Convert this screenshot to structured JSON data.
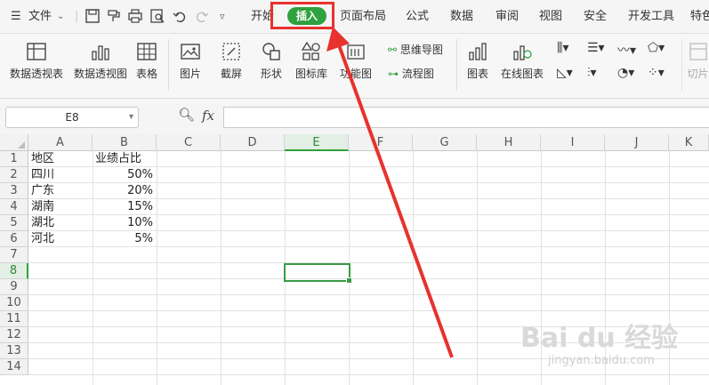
{
  "menu": {
    "file_label": "文件",
    "tabs": [
      "开始",
      "插入",
      "页面布局",
      "公式",
      "数据",
      "审阅",
      "视图",
      "安全",
      "开发工具",
      "特色"
    ]
  },
  "ribbon": {
    "buttons": [
      "数据透视表",
      "数据透视图",
      "表格",
      "图片",
      "截屏",
      "形状",
      "图标库",
      "功能图",
      "图表",
      "在线图表",
      "切片"
    ],
    "small": [
      "思维导图",
      "流程图"
    ]
  },
  "formula_bar": {
    "name_box": "E8",
    "fx": "fx"
  },
  "sheet": {
    "columns": [
      "A",
      "B",
      "C",
      "D",
      "E",
      "F",
      "G",
      "H",
      "I",
      "J",
      "K"
    ],
    "rows": [
      "1",
      "2",
      "3",
      "4",
      "5",
      "6",
      "7",
      "8",
      "9",
      "10",
      "11",
      "12",
      "13",
      "14"
    ],
    "header_row": {
      "a": "地区",
      "b": "业绩占比"
    },
    "data_rows": [
      {
        "a": "四川",
        "b": "50%"
      },
      {
        "a": "广东",
        "b": "20%"
      },
      {
        "a": "湖南",
        "b": "15%"
      },
      {
        "a": "湖北",
        "b": "10%"
      },
      {
        "a": "河北",
        "b": "5%"
      }
    ],
    "selected_cell": "E8"
  },
  "colors": {
    "accent": "#2fa13e",
    "annotation": "#e8322e"
  },
  "watermark": {
    "brand": "Bai du 经验",
    "url": "jingyan.baidu.com"
  }
}
